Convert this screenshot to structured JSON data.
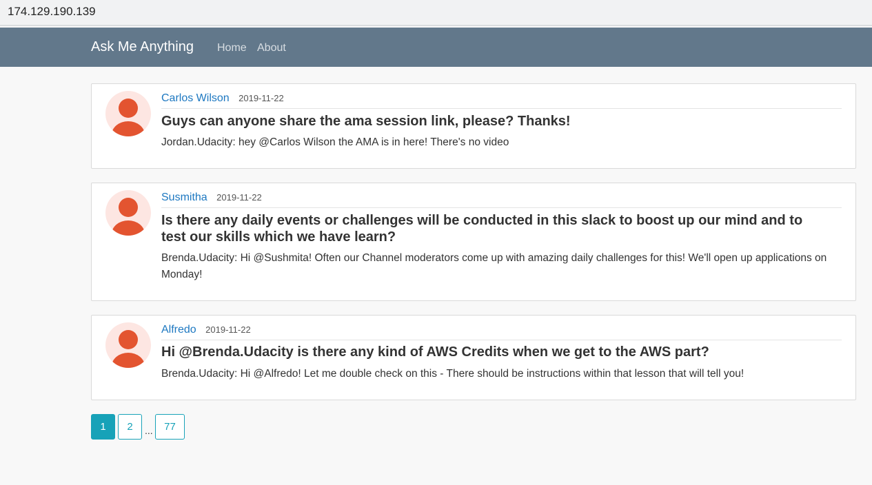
{
  "browser": {
    "url": "174.129.190.139"
  },
  "navbar": {
    "brand": "Ask Me Anything",
    "links": [
      "Home",
      "About"
    ]
  },
  "posts": [
    {
      "author": "Carlos Wilson",
      "date": "2019-11-22",
      "question": "Guys can anyone share the ama session link, please? Thanks!",
      "answer": "Jordan.Udacity: hey @Carlos Wilson the AMA is in here! There's no video"
    },
    {
      "author": "Susmitha",
      "date": "2019-11-22",
      "question": "Is there any daily events or challenges will be conducted in this slack to boost up our mind and to test our skills which we have learn?",
      "answer": "Brenda.Udacity: Hi @Sushmita! Often our Channel moderators come up with amazing daily challenges for this! We'll open up applications on Monday!"
    },
    {
      "author": "Alfredo",
      "date": "2019-11-22",
      "question": "Hi @Brenda.Udacity is there any kind of AWS Credits when we get to the AWS part?",
      "answer": "Brenda.Udacity: Hi @Alfredo! Let me double check on this - There should be instructions within that lesson that will tell you!"
    }
  ],
  "pagination": {
    "pages": [
      "1",
      "2",
      "77"
    ],
    "current": "1",
    "ellipsis": "..."
  },
  "colors": {
    "navbar": "#62788b",
    "accent": "#17a2b8",
    "avatar": "#e35430",
    "link": "#1d78c1"
  }
}
